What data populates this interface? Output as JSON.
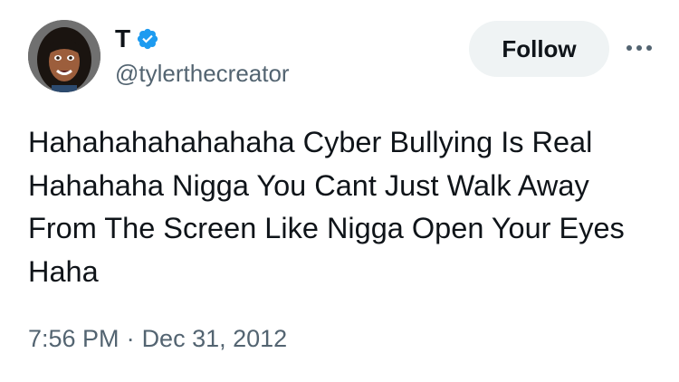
{
  "author": {
    "display_name": "T",
    "handle": "@tylerthecreator",
    "verified": true
  },
  "actions": {
    "follow_label": "Follow"
  },
  "tweet": {
    "text": "Hahahahahahahaha Cyber Bullying Is Real\nHahahaha Nigga You Cant Just Walk Away\nFrom The Screen Like Nigga Open Your Eyes\nHaha",
    "time": "7:56 PM",
    "separator": "·",
    "date": "Dec 31, 2012"
  },
  "colors": {
    "text": "#0f1419",
    "secondary": "#536471",
    "verified_badge": "#1d9bf0",
    "follow_bg": "#eff3f4"
  },
  "icons": {
    "verified": "verified-badge-icon",
    "more": "more-horizontal-icon"
  }
}
